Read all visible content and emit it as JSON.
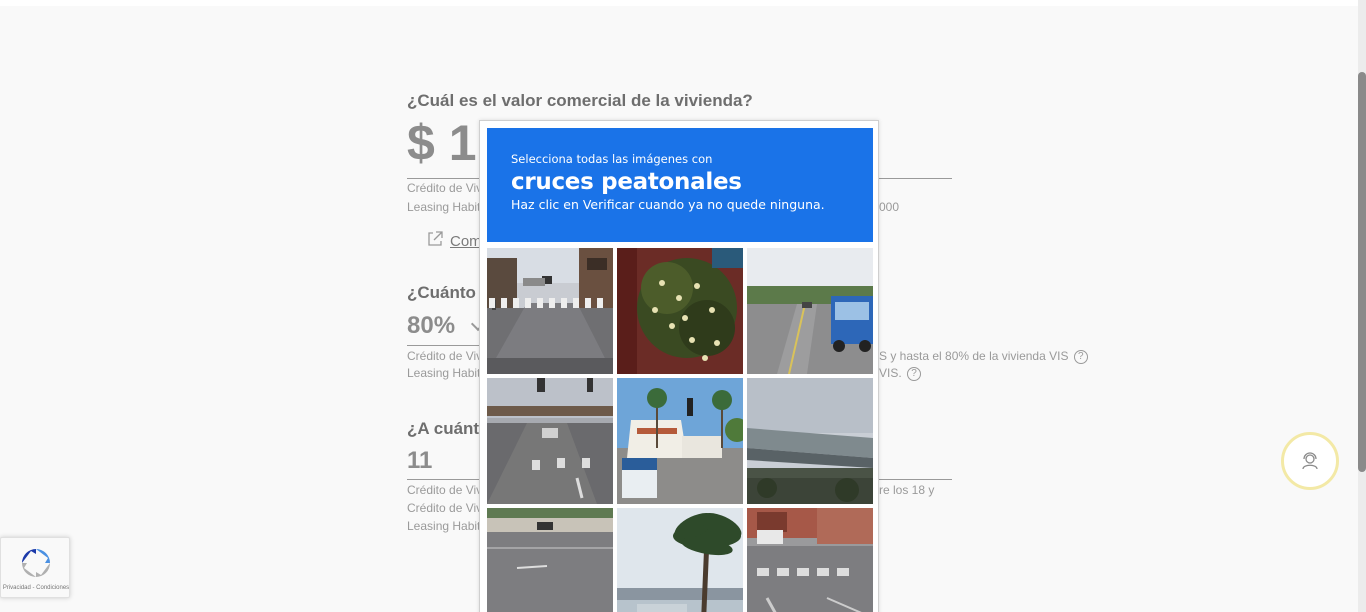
{
  "form": {
    "q1": "¿Cuál es el valor comercial de la vivienda?",
    "q1_value": "$ 1",
    "q1_note1": "Crédito de Viv",
    "q1_note2": "Leasing Habit",
    "q1_note2_end": "000",
    "q1_link": "Com",
    "q2": "¿Cuánto c",
    "q2_value": "80%",
    "q2_note1": "Crédito de Viv",
    "q2_note1_end": "S y hasta el 80% de la vivienda VIS",
    "q2_note2": "Leasing Habit",
    "q2_note2_end": "VIS.",
    "q3": "¿A cuánto",
    "q3_value": "11",
    "q3_note1": "Crédito de Viv",
    "q3_note1_end": "re los 18 y",
    "q3_note2": "Crédito de Viv",
    "q3_note3": "Leasing Habit"
  },
  "captcha": {
    "line1": "Selecciona todas las imágenes con",
    "object": "cruces peatonales",
    "line3": "Haz clic en Verificar cuando ya no quede ninguna.",
    "tiles": [
      "street-crosswalk",
      "tree-flowers",
      "road-bus",
      "street-traffic",
      "palm-building",
      "bridge",
      "highway",
      "palm-tree",
      "intersection"
    ]
  },
  "badge": {
    "text": "Privacidad - Condiciones"
  },
  "colors": {
    "banner": "#1a73e8",
    "support_ring": "#f3e9a6"
  },
  "support": {
    "icon": "agent-icon"
  }
}
